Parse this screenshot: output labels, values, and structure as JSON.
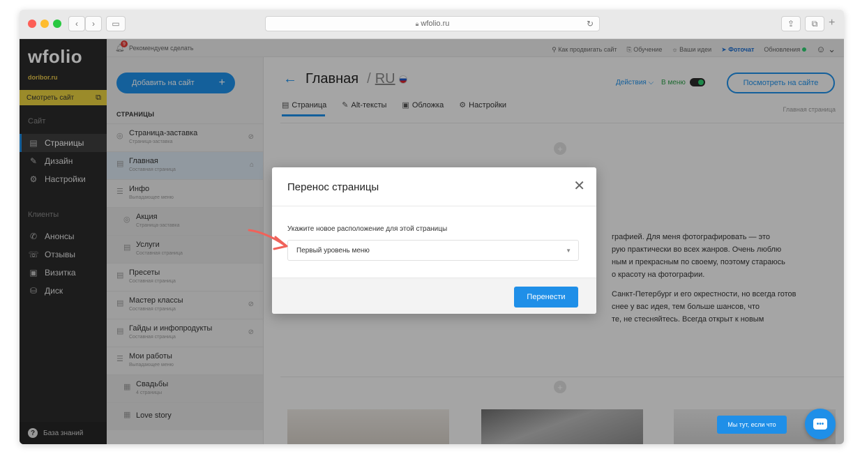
{
  "browser": {
    "url": "wfolio.ru"
  },
  "sidebar": {
    "logo": "wfolio",
    "domain": "doribor.ru",
    "view_site": "Смотреть сайт",
    "section_site": "Сайт",
    "section_clients": "Клиенты",
    "items_site": [
      {
        "label": "Страницы",
        "icon": "page-icon",
        "active": true
      },
      {
        "label": "Дизайн",
        "icon": "brush-icon",
        "active": false
      },
      {
        "label": "Настройки",
        "icon": "gear-icon",
        "active": false
      }
    ],
    "items_clients": [
      {
        "label": "Анонсы",
        "icon": "megaphone-icon"
      },
      {
        "label": "Отзывы",
        "icon": "reviews-icon"
      },
      {
        "label": "Визитка",
        "icon": "card-icon"
      },
      {
        "label": "Диск",
        "icon": "disk-icon"
      }
    ],
    "knowledge_base": "База знаний"
  },
  "topbar": {
    "recommend": "Рекомендуем сделать",
    "badge": "9",
    "links": [
      "Как продвигать сайт",
      "Обучение",
      "Ваши идеи",
      "Фоточат",
      "Обновления"
    ]
  },
  "pages_panel": {
    "add_button": "Добавить на сайт",
    "heading": "СТРАНИЦЫ",
    "pages": [
      {
        "title": "Страница-заставка",
        "sub": "Страница-заставка"
      },
      {
        "title": "Главная",
        "sub": "Составная страница"
      },
      {
        "title": "Инфо",
        "sub": "Выпадающее меню"
      },
      {
        "title": "Акция",
        "sub": "Страница-заставка"
      },
      {
        "title": "Услуги",
        "sub": "Составная страница"
      },
      {
        "title": "Пресеты",
        "sub": "Составная страница"
      },
      {
        "title": "Мастер классы",
        "sub": "Составная страница"
      },
      {
        "title": "Гайды и инфопродукты",
        "sub": "Составная страница"
      },
      {
        "title": "Мои работы",
        "sub": "Выпадающее меню"
      },
      {
        "title": "Свадьбы",
        "sub": "4 страницы"
      },
      {
        "title": "Love story",
        "sub": ""
      }
    ]
  },
  "main": {
    "title": "Главная",
    "lang": "RU",
    "actions": "Действия ⌵",
    "in_menu": "В меню",
    "view_button": "Посмотреть на сайте",
    "tabs": [
      "Страница",
      "Alt-тексты",
      "Обложка",
      "Настройки"
    ],
    "right_label": "Главная страница",
    "text_lines": [
      "графией. Для меня фотографировать — это",
      "рую практически во всех жанров. Очень люблю",
      "ным и прекрасным по своему, поэтому стараюсь",
      "о красоту на фотографии.",
      "Санкт-Петербург и его окрестности, но всегда готов",
      "снее у вас идея, тем больше шансов, что",
      "те, не стесняйтесь. Всегда открыт к новым"
    ]
  },
  "modal": {
    "title": "Перенос страницы",
    "label": "Укажите новое расположение для этой страницы",
    "selected": "Первый уровень меню",
    "move_button": "Перенести"
  },
  "chat": {
    "bubble": "Мы тут, если что"
  },
  "colors": {
    "accent": "#1f8fe8",
    "sidebar": "#2a2a2a",
    "highlight": "#e7cf3f",
    "arrow": "#f0625a"
  }
}
